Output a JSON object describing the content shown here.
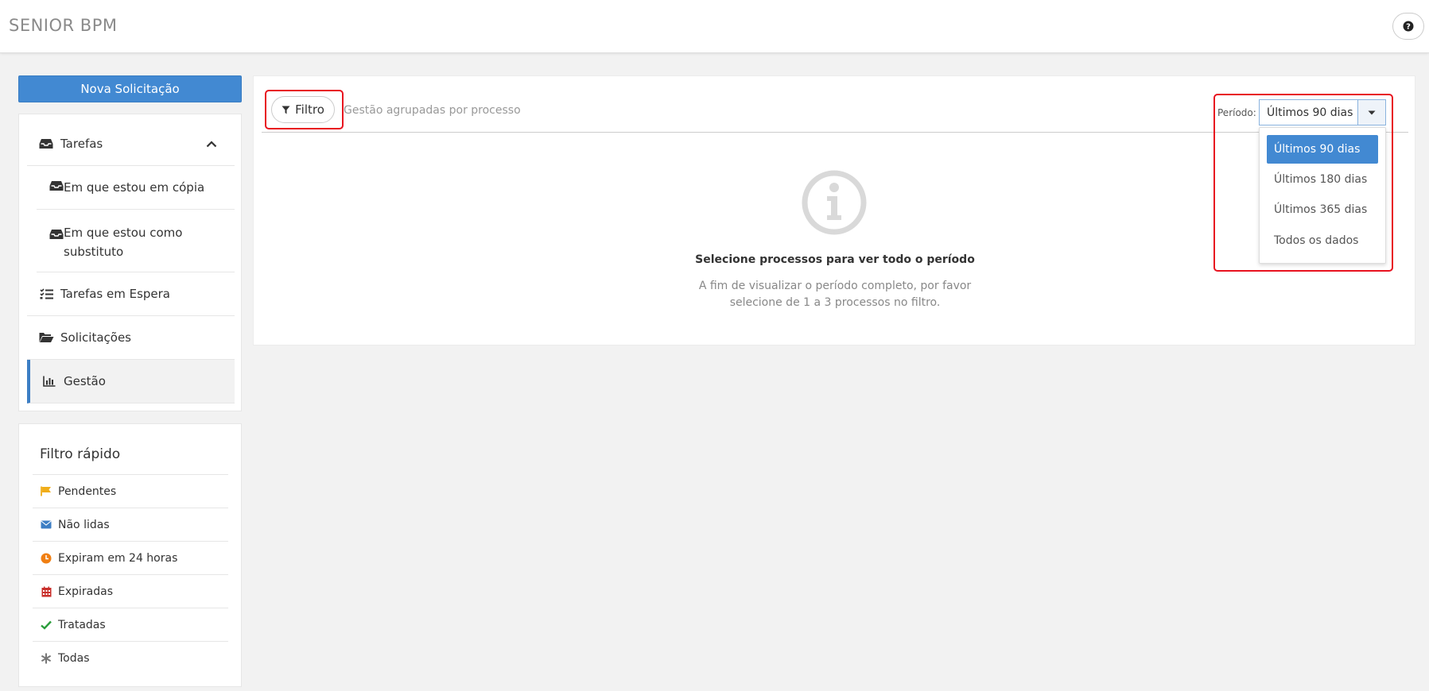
{
  "header": {
    "brand": "SENIOR BPM",
    "help_icon": "question-circle-icon"
  },
  "sidebar": {
    "new_request_label": "Nova Solicitação",
    "nav": {
      "tasks": {
        "label": "Tarefas",
        "icon": "inbox-icon",
        "expanded": true
      },
      "tasks_copy": {
        "label": "Em que estou em cópia",
        "icon": "inbox-icon"
      },
      "tasks_substitute": {
        "label": "Em que estou como substituto",
        "icon": "inbox-icon"
      },
      "waiting": {
        "label": "Tarefas em Espera",
        "icon": "tasks-list-icon"
      },
      "requests": {
        "label": "Solicitações",
        "icon": "folder-open-icon"
      },
      "management": {
        "label": "Gestão",
        "icon": "bar-chart-icon",
        "active": true
      }
    },
    "quick_filter": {
      "title": "Filtro rápido",
      "items": [
        {
          "label": "Pendentes",
          "icon": "flag-icon",
          "color": "#f0ad1a"
        },
        {
          "label": "Não lidas",
          "icon": "envelope-icon",
          "color": "#3c7ec4"
        },
        {
          "label": "Expiram em 24 horas",
          "icon": "clock-icon",
          "color": "#f07f13"
        },
        {
          "label": "Expiradas",
          "icon": "calendar-icon",
          "color": "#c9302c"
        },
        {
          "label": "Tratadas",
          "icon": "check-icon",
          "color": "#2a9d3b"
        },
        {
          "label": "Todas",
          "icon": "asterisk-icon",
          "color": "#777777"
        }
      ]
    }
  },
  "main": {
    "filter_label": "Filtro",
    "group_text": "Gestão agrupadas por processo",
    "empty_title": "Selecione processos para ver todo o período",
    "empty_desc": "A fim de visualizar o período completo, por favor selecione de 1 a 3 processos no filtro.",
    "period": {
      "label": "Período:",
      "selected": "Últimos 90 dias",
      "options": [
        "Últimos 90 dias",
        "Últimos 180 dias",
        "Últimos 365 dias",
        "Todos os dados"
      ]
    }
  },
  "colors": {
    "accent": "#4289d2",
    "highlight": "#e8121f"
  }
}
